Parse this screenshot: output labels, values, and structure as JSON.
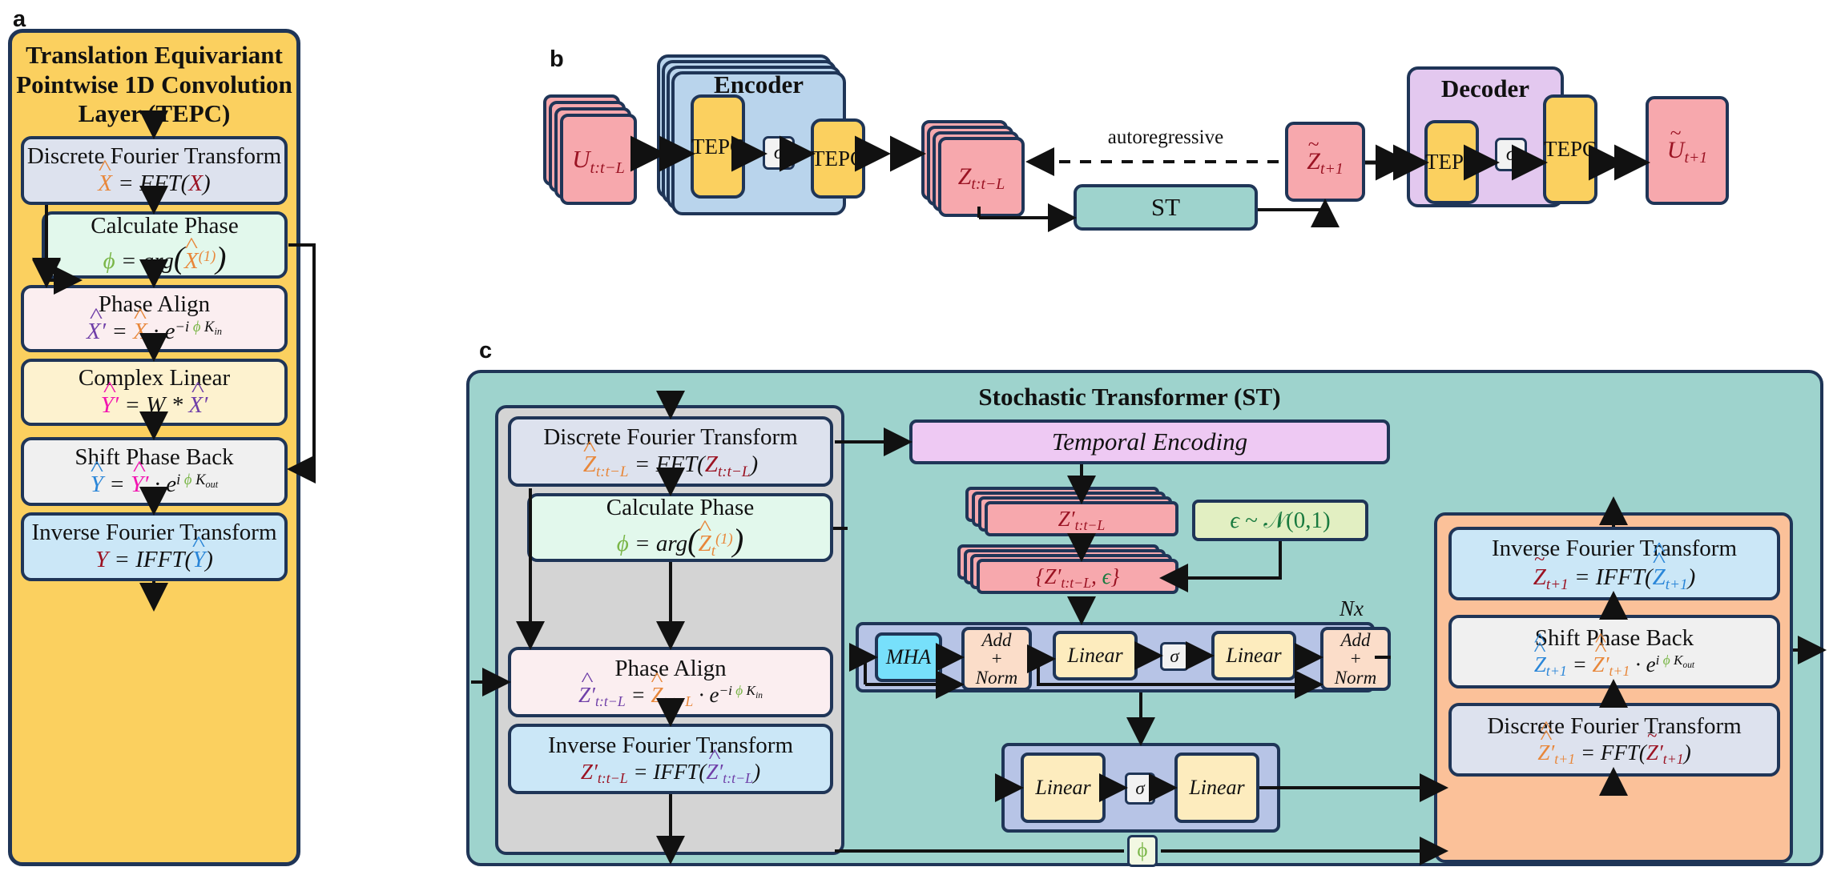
{
  "panels": {
    "a": {
      "letter": "a",
      "title": "Translation Equivariant Pointwise 1D Convolution Layer (TEPC)",
      "blocks": [
        {
          "title": "Discrete Fourier Transform",
          "eq": "X̂ = FFT(X)"
        },
        {
          "title": "Calculate Phase",
          "eq": "ϕ = arg(X̂⁽¹⁾)"
        },
        {
          "title": "Phase Align",
          "eq": "X̂′ = X̂ · e⁻ⁱ ϕ K_in"
        },
        {
          "title": "Complex Linear",
          "eq": "Ŷ′ = W * X̂′"
        },
        {
          "title": "Shift Phase Back",
          "eq": "Ŷ = Ŷ′ · eⁱ ϕ K_out"
        },
        {
          "title": "Inverse Fourier Transform",
          "eq": "Y = IFFT(Ŷ)"
        }
      ]
    },
    "b": {
      "letter": "b",
      "input_label": "U_{t:t-L}",
      "encoder_label": "Encoder",
      "encoder_stages": [
        "TEPC",
        "σ",
        "TEPC"
      ],
      "latent_label": "Z_{t:t-L}",
      "autoregressive_label": "autoregressive",
      "st_label": "ST",
      "latent_pred_label": "Z̃_{t+1}",
      "decoder_label": "Decoder",
      "decoder_stages": [
        "TEPC",
        "σ",
        "TEPC"
      ],
      "output_label": "Ũ_{t+1}"
    },
    "c": {
      "letter": "c",
      "title": "Stochastic Transformer (ST)",
      "left_blocks": [
        {
          "title": "Discrete Fourier Transform",
          "eq": "Ẑ_{t:t-L} = FFT(Z_{t:t-L})"
        },
        {
          "title": "Calculate Phase",
          "eq": "ϕ = arg(Ẑ_t⁽¹⁾)"
        },
        {
          "title": "Phase Align",
          "eq": "Ẑ′_{t:t-L} = Ẑ_{t:t-L} · e⁻ⁱ ϕ K_in"
        },
        {
          "title": "Inverse Fourier Transform",
          "eq": "Z′_{t:t-L} = IFFT(Ẑ′_{t:t-L})"
        }
      ],
      "temporal_encoding_label": "Temporal Encoding",
      "z_prime_label": "Z′_{t:t-L}",
      "noise_label": "ϵ ~ 𝒩(0,1)",
      "z_prime_eps_label": "{Z′_{t:t-L}, ϵ}",
      "repeat_label": "Nx",
      "transformer_stages": [
        "MHA",
        "Add + Norm",
        "Linear",
        "σ",
        "Linear",
        "Add + Norm"
      ],
      "head_stages": [
        "Linear",
        "σ",
        "Linear"
      ],
      "phi_label": "ϕ",
      "right_blocks": [
        {
          "title": "Inverse Fourier Transform",
          "eq": "Z̃_{t+1} = IFFT(Ẑ̃_{t+1})"
        },
        {
          "title": "Shift Phase Back",
          "eq": "Ẑ̃_{t+1} = Ẑ̃′_{t+1} · eⁱ ϕ K_out"
        },
        {
          "title": "Discrete Fourier Transform",
          "eq": "Ẑ̃′_{t+1} = FFT(Z̃′_{t+1})"
        }
      ]
    }
  },
  "colors": {
    "outline": "#1f3557",
    "yellow": "#fbd05f",
    "teal": "#9ed3cd",
    "rose": "#f7a8ad",
    "encoder_blue": "#b9d4ec",
    "decoder_purple": "#e3c8ef",
    "orange": "#fbc199",
    "lilac": "#b7c4e6",
    "cyan": "#77e0fb"
  }
}
